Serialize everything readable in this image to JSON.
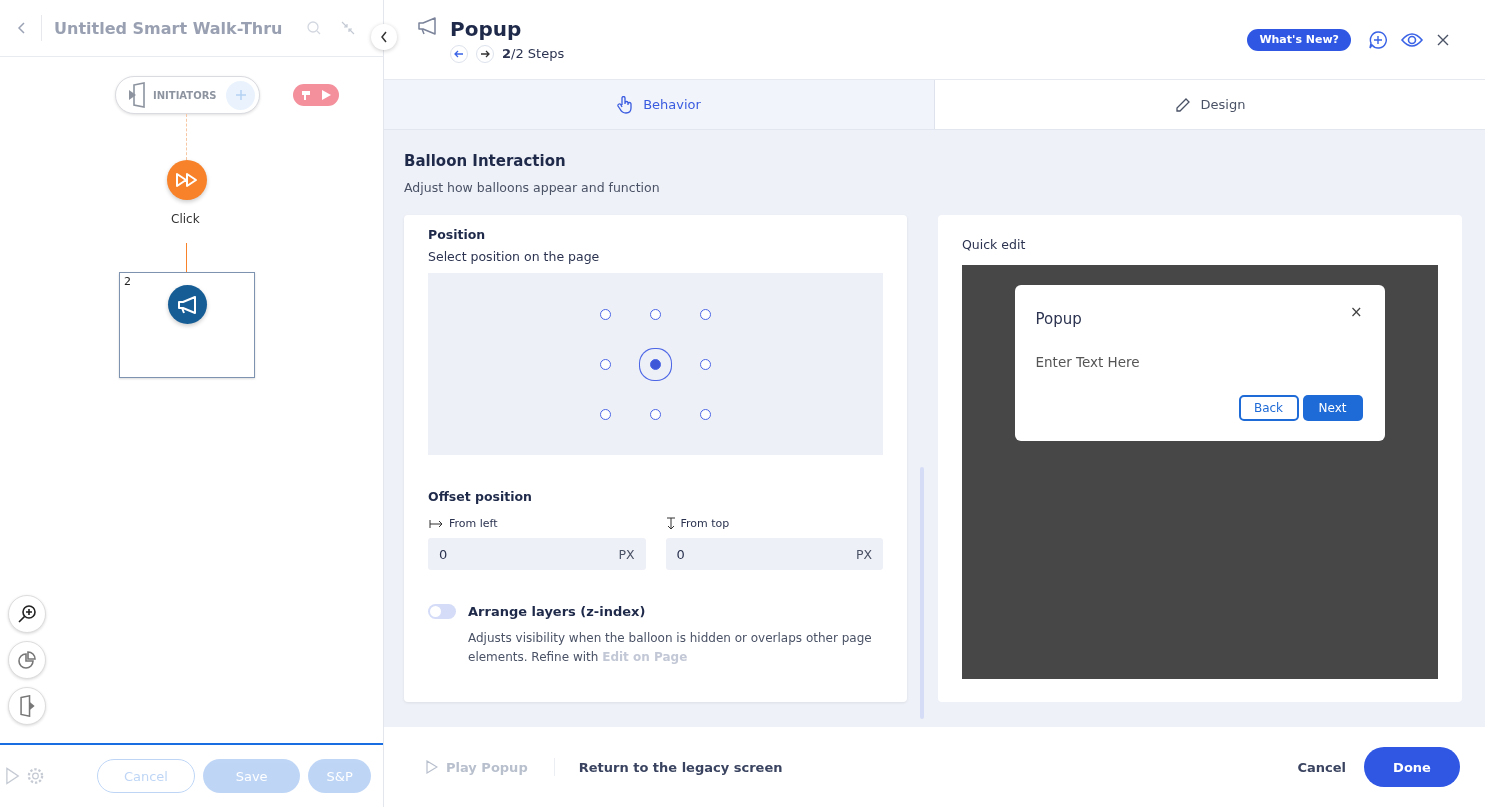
{
  "sidebar": {
    "title": "Untitled Smart Walk-Thru",
    "initiators_label": "INITIATORS",
    "trigger_label": "Click",
    "step_number": "2",
    "footer_buttons": [
      {
        "label": "Cancel",
        "kind": "outline",
        "disabled": true
      },
      {
        "label": "Save",
        "kind": "filled",
        "disabled": true
      },
      {
        "label": "S&P",
        "kind": "filled",
        "disabled": true
      }
    ]
  },
  "header": {
    "title": "Popup",
    "steps": "**2**/2 Steps",
    "whats_new": "What's New?"
  },
  "tabs": [
    {
      "label": "Behavior",
      "selected": true
    },
    {
      "label": "Design",
      "selected": false
    }
  ],
  "section": {
    "title": "Balloon Interaction",
    "subtitle": "Adjust how balloons appear and function"
  },
  "position": {
    "label": "Position",
    "hint": "Select position on the page",
    "points": [
      {
        "selected": false
      },
      {
        "selected": false
      },
      {
        "selected": false
      },
      {
        "selected": false
      },
      {
        "selected": true
      },
      {
        "selected": false
      },
      {
        "selected": false
      },
      {
        "selected": false
      },
      {
        "selected": false
      }
    ]
  },
  "offset": {
    "title": "Offset position",
    "fields": [
      {
        "label": "From left",
        "value": "0",
        "unit": "PX",
        "kind": "left"
      },
      {
        "label": "From top",
        "value": "0",
        "unit": "PX",
        "kind": "top"
      }
    ]
  },
  "layers": {
    "label": "Arrange layers (z-index)",
    "on": false,
    "description": "Adjusts visibility when the balloon is hidden or overlaps other page elements. Refine with",
    "link": "Edit on Page"
  },
  "preview": {
    "label": "Quick edit",
    "popup_title": "Popup",
    "close": "×",
    "body": "Enter Text Here",
    "buttons": [
      {
        "label": "Back",
        "kind": "secondary"
      },
      {
        "label": "Next",
        "kind": "primary"
      }
    ]
  },
  "footer": {
    "play": {
      "label": "Play Popup",
      "disabled": true
    },
    "legacy": "Return to the legacy screen",
    "cancel": "Cancel",
    "done": "Done"
  }
}
